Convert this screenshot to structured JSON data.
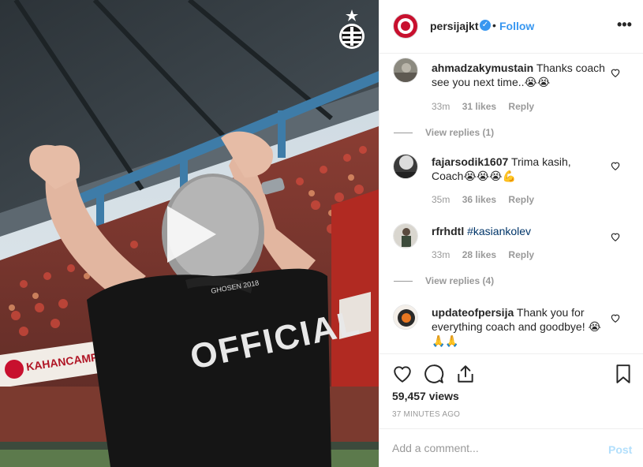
{
  "media": {
    "shirt_text": "OFFICIAL",
    "collar_text": "GHOSEN 2018",
    "banner_text": "KAHANCAMPEL"
  },
  "header": {
    "username": "persijajkt",
    "separator": "•",
    "follow_label": "Follow",
    "more_label": "•••"
  },
  "comments": [
    {
      "username": "ahmadzakymustain",
      "text": "Thanks coach see you next time..😭😭",
      "time": "33m",
      "likes": "31 likes",
      "reply_label": "Reply",
      "view_replies": "View replies (1)"
    },
    {
      "username": "fajarsodik1607",
      "text": "Trima kasih, Coach😭😭😭💪",
      "time": "35m",
      "likes": "36 likes",
      "reply_label": "Reply",
      "view_replies": ""
    },
    {
      "username": "rfrhdtl",
      "text": "",
      "hashtag": "#kasiankolev",
      "time": "33m",
      "likes": "28 likes",
      "reply_label": "Reply",
      "view_replies": "View replies (4)"
    },
    {
      "username": "updateofpersija",
      "text": "Thank you for everything coach and goodbye! 😭🙏🙏",
      "time": "",
      "likes": "",
      "reply_label": "",
      "view_replies": ""
    }
  ],
  "actions": {
    "views": "59,457 views",
    "time_ago": "37 MINUTES AGO"
  },
  "add_comment": {
    "placeholder": "Add a comment...",
    "post_label": "Post"
  },
  "colors": {
    "accent": "#3897f0",
    "brand_red": "#c8102e",
    "post_disabled": "#b2dffc"
  }
}
